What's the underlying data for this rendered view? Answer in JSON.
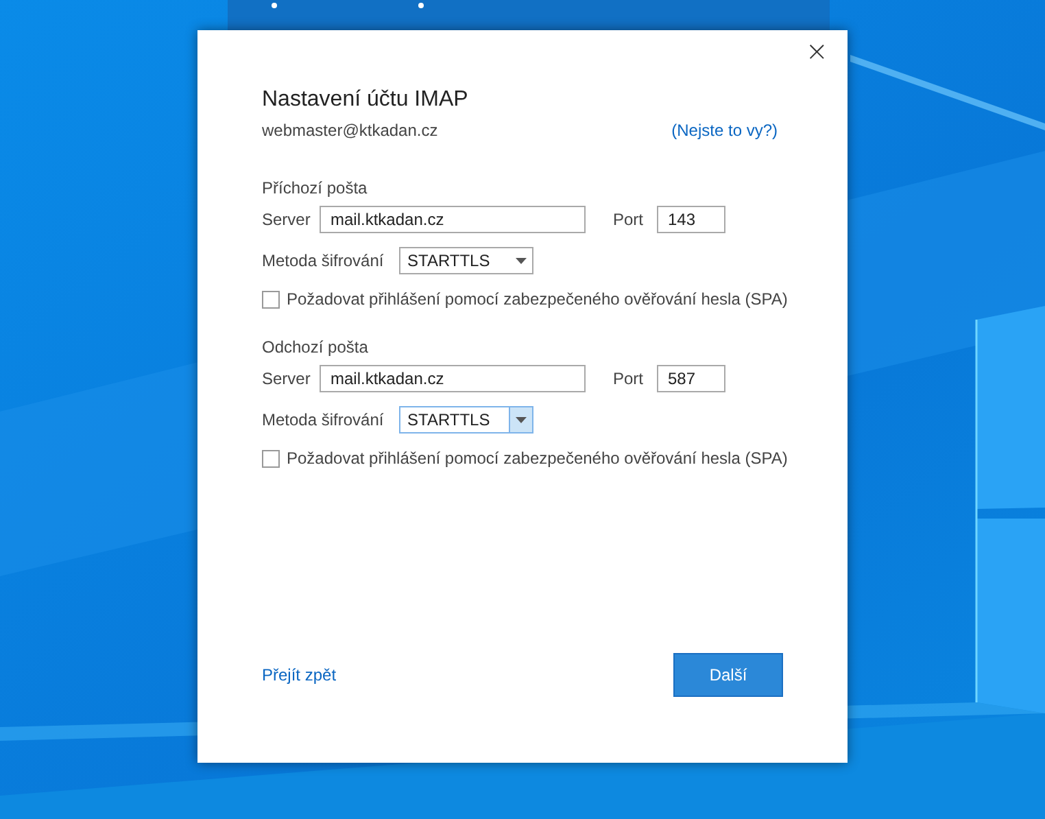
{
  "dialog": {
    "title": "Nastavení účtu IMAP",
    "account": "webmaster@ktkadan.cz",
    "not_you_link": "(Nejste to vy?)",
    "close_icon": "×",
    "sections": [
      {
        "heading": "Příchozí pošta",
        "server_label": "Server",
        "server": "mail.ktkadan.cz",
        "port_label": "Port",
        "port": "143",
        "encryption_label": "Metoda šifrování",
        "encryption": "STARTTLS",
        "dropdown_focused": false,
        "spa_label": "Požadovat přihlášení pomocí zabezpečeného ověřování hesla (SPA)",
        "spa_checked": false
      },
      {
        "heading": "Odchozí pošta",
        "server_label": "Server",
        "server": "mail.ktkadan.cz",
        "port_label": "Port",
        "port": "587",
        "encryption_label": "Metoda šifrování",
        "encryption": "STARTTLS",
        "dropdown_focused": true,
        "spa_label": "Požadovat přihlášení pomocí zabezpečeného ověřování hesla (SPA)",
        "spa_checked": false
      }
    ],
    "back_link": "Přejít zpět",
    "next_button": "Další"
  }
}
